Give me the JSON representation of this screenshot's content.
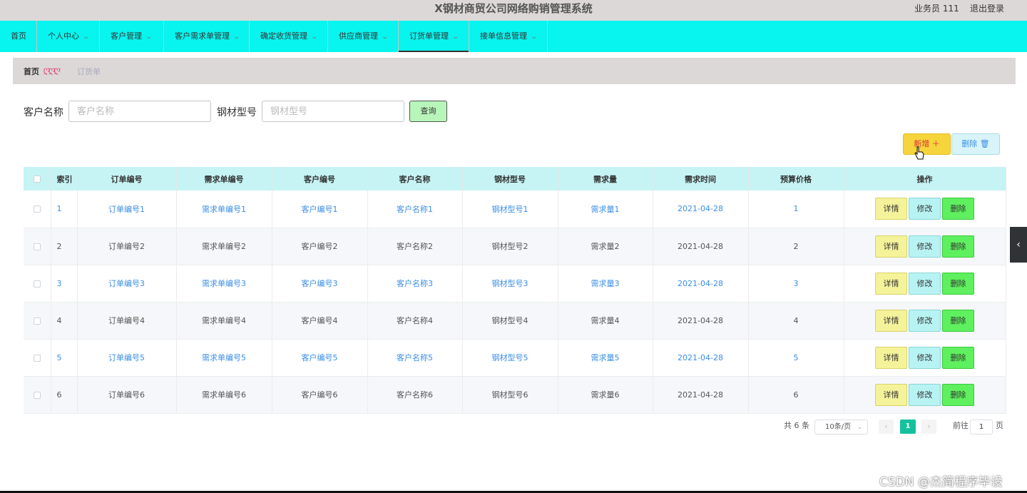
{
  "header": {
    "title": "X钢材商贸公司网络购销管理系统",
    "user": "业务员 111",
    "logout": "退出登录"
  },
  "nav": [
    {
      "label": "首页",
      "dropdown": false
    },
    {
      "label": "个人中心",
      "dropdown": true
    },
    {
      "label": "客户管理",
      "dropdown": true
    },
    {
      "label": "客户需求单管理",
      "dropdown": true
    },
    {
      "label": "确定收货管理",
      "dropdown": true
    },
    {
      "label": "供应商管理",
      "dropdown": true
    },
    {
      "label": "订货单管理",
      "dropdown": true,
      "active": true
    },
    {
      "label": "接单信息管理",
      "dropdown": true
    }
  ],
  "breadcrumb": {
    "home": "首页",
    "separator": "ღღღ",
    "current": "订货单"
  },
  "search": {
    "customer_label": "客户名称",
    "customer_placeholder": "客户名称",
    "steel_label": "钢材型号",
    "steel_placeholder": "钢材型号",
    "query_button": "查询"
  },
  "actions": {
    "add": "新增 ＋",
    "delete": "删除 🗑"
  },
  "table": {
    "columns": [
      "索引",
      "订单编号",
      "需求单编号",
      "客户编号",
      "客户名称",
      "钢材型号",
      "需求量",
      "需求时间",
      "预算价格",
      "操作"
    ],
    "rows": [
      {
        "index": "1",
        "order_no": "订单编号1",
        "demand_no": "需求单编号1",
        "customer_no": "客户编号1",
        "customer_name": "客户名称1",
        "steel_model": "钢材型号1",
        "demand_qty": "需求量1",
        "demand_time": "2021-04-28",
        "budget": "1"
      },
      {
        "index": "2",
        "order_no": "订单编号2",
        "demand_no": "需求单编号2",
        "customer_no": "客户编号2",
        "customer_name": "客户名称2",
        "steel_model": "钢材型号2",
        "demand_qty": "需求量2",
        "demand_time": "2021-04-28",
        "budget": "2"
      },
      {
        "index": "3",
        "order_no": "订单编号3",
        "demand_no": "需求单编号3",
        "customer_no": "客户编号3",
        "customer_name": "客户名称3",
        "steel_model": "钢材型号3",
        "demand_qty": "需求量3",
        "demand_time": "2021-04-28",
        "budget": "3"
      },
      {
        "index": "4",
        "order_no": "订单编号4",
        "demand_no": "需求单编号4",
        "customer_no": "客户编号4",
        "customer_name": "客户名称4",
        "steel_model": "钢材型号4",
        "demand_qty": "需求量4",
        "demand_time": "2021-04-28",
        "budget": "4"
      },
      {
        "index": "5",
        "order_no": "订单编号5",
        "demand_no": "需求单编号5",
        "customer_no": "客户编号5",
        "customer_name": "客户名称5",
        "steel_model": "钢材型号5",
        "demand_qty": "需求量5",
        "demand_time": "2021-04-28",
        "budget": "5"
      },
      {
        "index": "6",
        "order_no": "订单编号6",
        "demand_no": "需求单编号6",
        "customer_no": "客户编号6",
        "customer_name": "客户名称6",
        "steel_model": "钢材型号6",
        "demand_qty": "需求量6",
        "demand_time": "2021-04-28",
        "budget": "6"
      }
    ],
    "row_actions": {
      "detail": "详情",
      "edit": "修改",
      "delete": "删除"
    }
  },
  "pagination": {
    "total": "共 6 条",
    "page_size": "10条/页",
    "prev": "‹",
    "current_page": "1",
    "next": "›",
    "goto_label": "前往",
    "goto_value": "1",
    "page_suffix": "页"
  },
  "side_tab": "‹",
  "watermark": "CSDN @杰简程序毕设",
  "colors": {
    "nav_bg": "#08f4ee",
    "header_bg": "#dcd8d8",
    "table_header_bg": "#c6f3f4",
    "link_blue": "#3a8ee6",
    "pager_active": "#13c29c",
    "detail_btn": "#f5f39a",
    "edit_btn": "#b8f3f3",
    "delete_btn": "#5ef05e",
    "add_btn": "#f5d43c"
  }
}
